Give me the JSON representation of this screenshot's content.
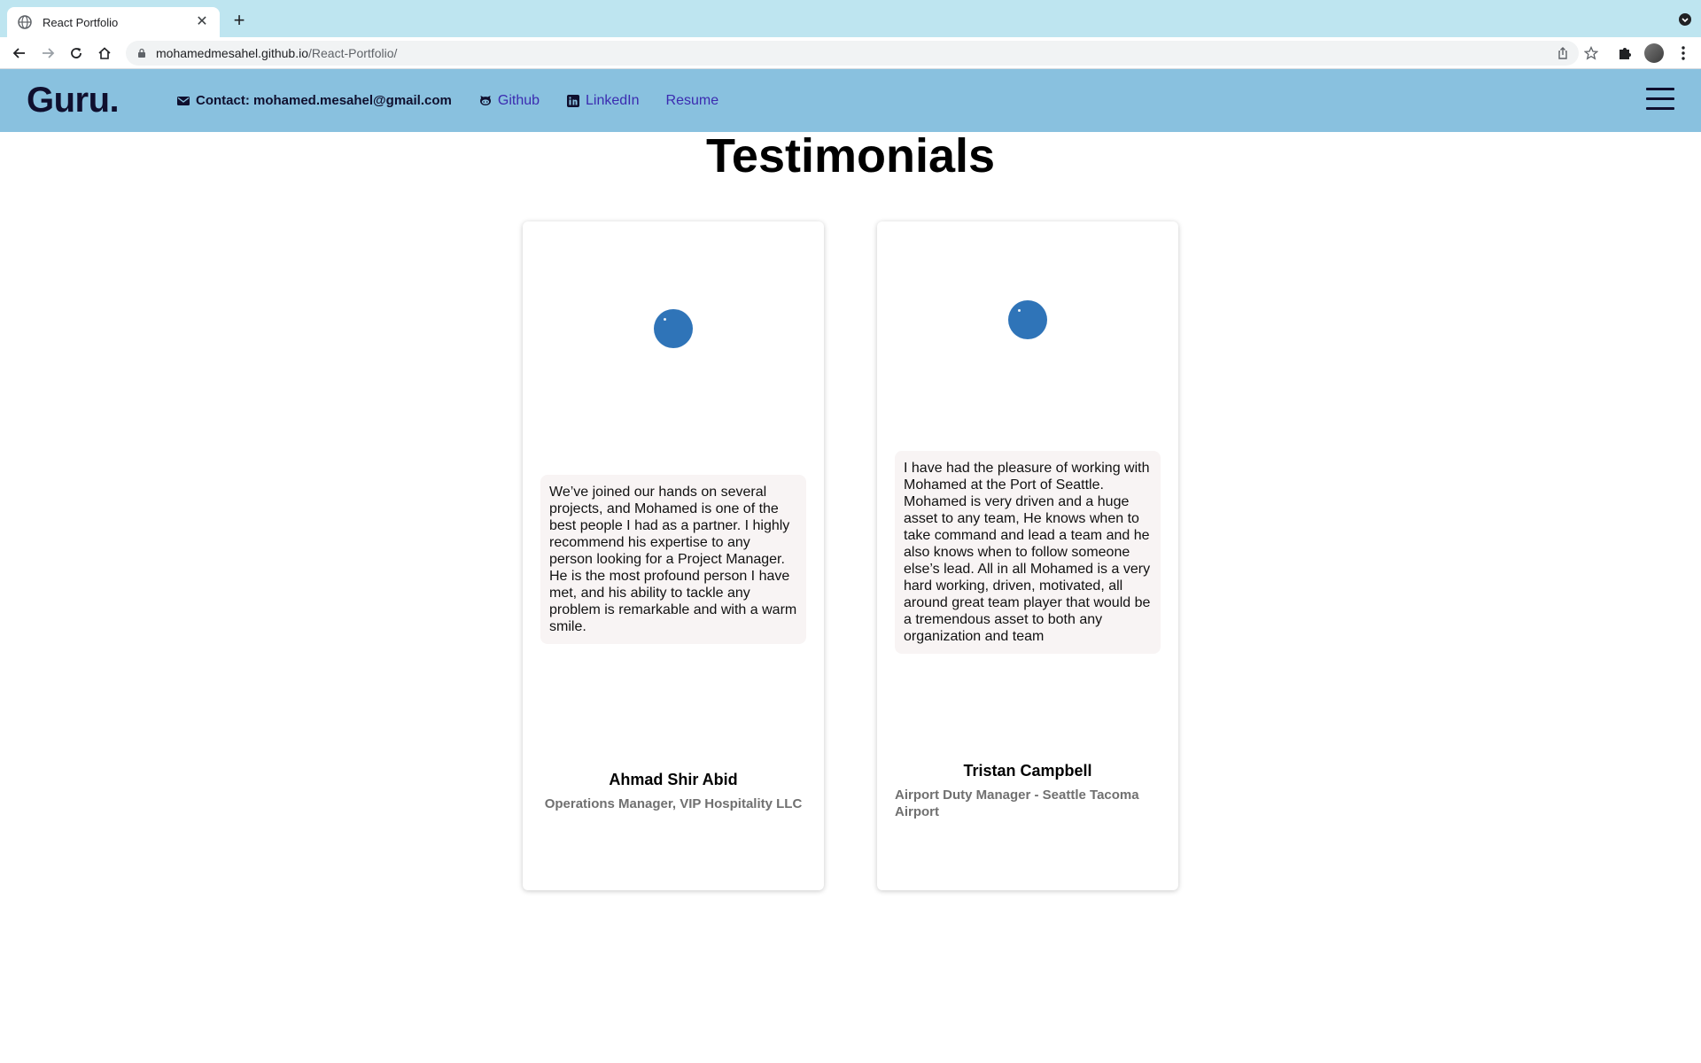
{
  "browser": {
    "tab_title": "React Portfolio",
    "tab_close": "✕",
    "new_tab": "+",
    "url_host": "mohamedmesahel.github.io",
    "url_path": "/React-Portfolio/"
  },
  "header": {
    "logo": "Guru.",
    "contact": "Contact: mohamed.mesahel@gmail.com",
    "github": "Github",
    "linkedin": "LinkedIn",
    "resume": "Resume"
  },
  "section": {
    "title": "Testimonials"
  },
  "testimonials": [
    {
      "quote": "We’ve joined our hands on several projects, and Mohamed is one of the best people I had as a partner. I highly recommend his expertise to any person looking for a Project Manager. He is the most profound person I have met, and his ability to tackle any problem is remarkable and with a warm smile.",
      "name": "Ahmad Shir Abid",
      "title": "Operations Manager, VIP Hospitality LLC"
    },
    {
      "quote": "I have had the pleasure of working with Mohamed at the Port of Seattle. Mohamed is very driven and a huge asset to any team, He knows when to take command and lead a team and he also knows when to follow someone else’s lead. All in all Mohamed is a very hard working, driven, motivated, all around great team player that would be a tremendous asset to both any organization and team",
      "name": "Tristan Campbell",
      "title": "Airport Duty Manager - Seattle Tacoma Airport"
    }
  ],
  "colors": {
    "header_bg": "#89c1df",
    "logo": "#0f0f2e",
    "link": "#3b2bb0",
    "avatar": "#2f74b8",
    "quote_bg": "#f8f4f4",
    "tabstrip": "#bee5f0"
  },
  "icons": [
    "globe-icon",
    "close-icon",
    "plus-icon",
    "chevron-down-icon",
    "back-icon",
    "forward-icon",
    "reload-icon",
    "home-icon",
    "lock-icon",
    "share-icon",
    "star-icon",
    "puzzle-icon",
    "more-vert-icon",
    "mail-icon",
    "github-icon",
    "linkedin-icon",
    "hamburger-icon"
  ]
}
